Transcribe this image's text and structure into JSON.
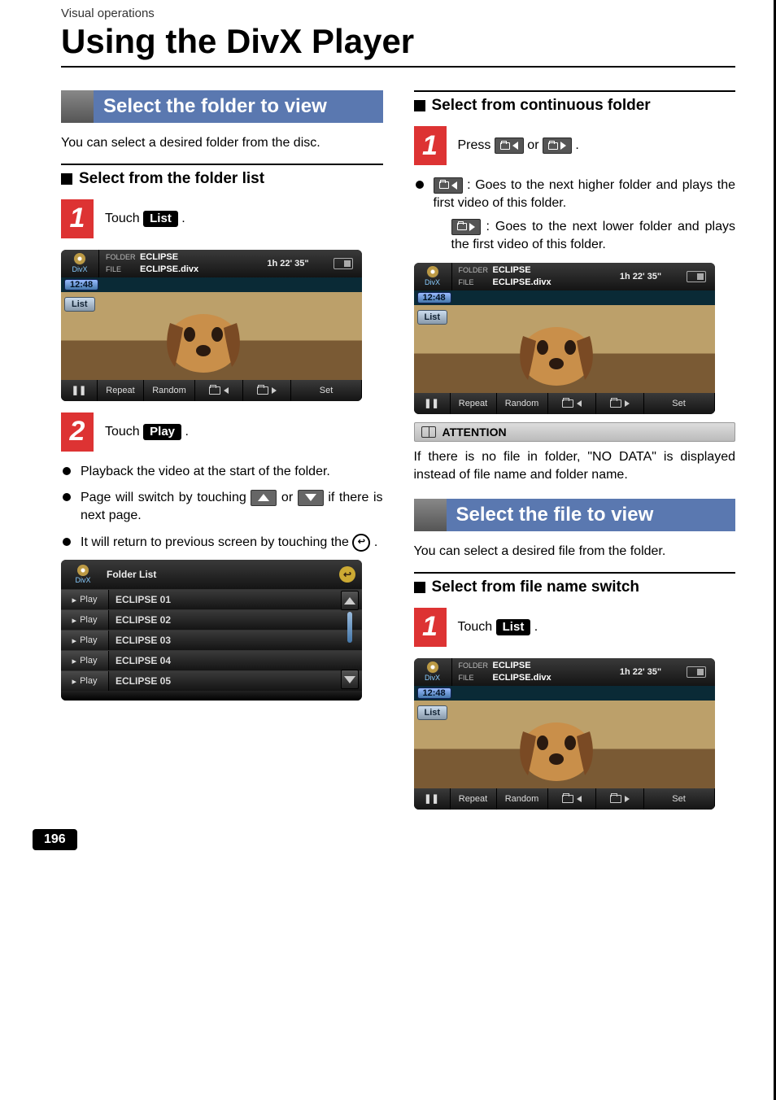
{
  "breadcrumb": "Visual operations",
  "page_title": "Using the DivX Player",
  "page_number": "196",
  "left": {
    "section_title": "Select the folder to view",
    "intro": "You can select a desired folder from the disc.",
    "sub1_title": "Select from the folder list",
    "step1_text_pre": "Touch ",
    "step1_btn": "List",
    "step1_text_post": " .",
    "step2_text_pre": "Touch ",
    "step2_btn": "Play",
    "step2_text_post": " .",
    "bul1": "Playback the video at the start of the folder.",
    "bul2_pre": "Page will switch by touching ",
    "bul2_mid": " or ",
    "bul2_post": " if there is next page.",
    "bul3_pre": "It will return to previous screen by touching the ",
    "bul3_post": "."
  },
  "right": {
    "sub2_title": "Select from continuous folder",
    "step1_text_pre": "Press ",
    "step1_text_mid": " or ",
    "step1_text_post": " .",
    "b1_post": " : Goes to the next higher folder and plays the first video of this folder.",
    "b2_post": " : Goes to the next lower folder and plays the first video of this folder.",
    "attention_label": "ATTENTION",
    "attention_body": "If there is no file in folder, \"NO DATA\" is displayed instead of file name and folder name.",
    "section2_title": "Select the file to view",
    "section2_intro": "You can select a desired file from the folder.",
    "sub3_title": "Select from file name switch",
    "s3_step1_pre": "Touch ",
    "s3_step1_btn": "List",
    "s3_step1_post": " ."
  },
  "player": {
    "brand": "DivX",
    "meta_folder_label": "FOLDER",
    "meta_folder_value": "ECLIPSE",
    "meta_file_label": "FILE",
    "meta_file_value": "ECLIPSE.divx",
    "duration": "1h 22' 35\"",
    "clock": "12:48",
    "list_btn": "List",
    "btn_repeat": "Repeat",
    "btn_random": "Random",
    "btn_set": "Set"
  },
  "folder_list": {
    "title": "Folder List",
    "brand": "DivX",
    "play_label": "Play",
    "items": [
      {
        "name": "ECLIPSE 01"
      },
      {
        "name": "ECLIPSE 02"
      },
      {
        "name": "ECLIPSE 03"
      },
      {
        "name": "ECLIPSE 04"
      },
      {
        "name": "ECLIPSE 05"
      }
    ]
  }
}
